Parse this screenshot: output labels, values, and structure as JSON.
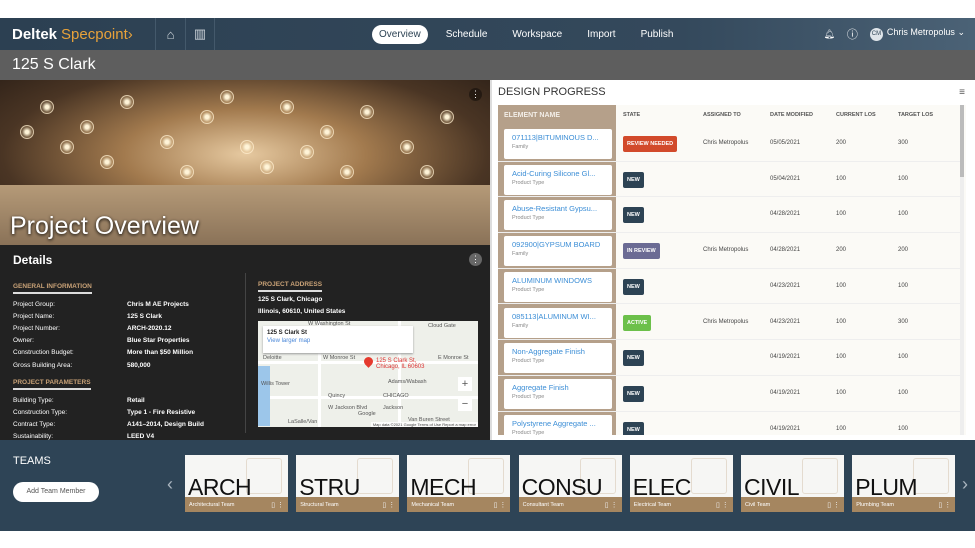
{
  "header": {
    "brand": "Deltek",
    "product": "Specpoint",
    "product_suffix": "›",
    "nav": [
      "Overview",
      "Schedule",
      "Workspace",
      "Import",
      "Publish"
    ],
    "active_tab": "Overview",
    "user_initials": "CM",
    "user_name": "Chris Metropolus",
    "user_chevron": "⌄"
  },
  "page_title": "125 S Clark",
  "hero": {
    "title": "Project Overview"
  },
  "details": {
    "title": "Details",
    "general_heading": "GENERAL INFORMATION",
    "general": [
      {
        "k": "Project Group:",
        "v": "Chris M AE Projects"
      },
      {
        "k": "Project Name:",
        "v": "125 S Clark"
      },
      {
        "k": "Project Number:",
        "v": "ARCH-2020.12"
      },
      {
        "k": "Owner:",
        "v": "Blue Star Properties"
      },
      {
        "k": "Construction Budget:",
        "v": "More than $50 Million"
      },
      {
        "k": "Gross Building Area:",
        "v": "580,000"
      }
    ],
    "params_heading": "PROJECT PARAMETERS",
    "params": [
      {
        "k": "Building Type:",
        "v": "Retail"
      },
      {
        "k": "Construction Type:",
        "v": "Type 1 - Fire Resistive"
      },
      {
        "k": "Contract Type:",
        "v": "A141–2014, Design Build"
      },
      {
        "k": "Sustainability:",
        "v": "LEED V4"
      }
    ],
    "address_heading": "PROJECT ADDRESS",
    "address_line1": "125 S Clark, Chicago",
    "address_line2": "Illinois, 60610, United States",
    "map": {
      "card_title": "125 S Clark St",
      "card_link": "View larger map",
      "pin_label_1": "125 S Clark St,",
      "pin_label_2": "Chicago, IL 60603",
      "labels": [
        "W Washington St",
        "Cloud Gate",
        "Deloitte",
        "W Monroe St",
        "E Monroe St",
        "Willis Tower",
        "Adams/Wabash",
        "Quincy",
        "W Jackson Blvd",
        "Jackson",
        "CHICAGO",
        "Van Buren Street",
        "LaSalle/Van",
        "Google"
      ],
      "footer": "Map data ©2021 Google   Terms of Use   Report a map error",
      "zoom_in": "+",
      "zoom_out": "−"
    }
  },
  "design_progress": {
    "title": "DESIGN PROGRESS",
    "columns": [
      "ELEMENT NAME",
      "STATE",
      "ASSIGNED TO",
      "DATE MODIFIED",
      "CURRENT LOS",
      "TARGET LOS"
    ],
    "rows": [
      {
        "name": "071113|BITUMINOUS D...",
        "type": "Family",
        "state": "REVIEW NEEDED",
        "state_color": "#d24a2b",
        "assigned": "Chris Metropolus",
        "date": "05/05/2021",
        "current": "200",
        "target": "300"
      },
      {
        "name": "Acid-Curing Silicone Gl...",
        "type": "Product Type",
        "state": "NEW",
        "state_color": "#2d4354",
        "assigned": "",
        "date": "05/04/2021",
        "current": "100",
        "target": "100"
      },
      {
        "name": "Abuse-Resistant Gypsu...",
        "type": "Product Type",
        "state": "NEW",
        "state_color": "#2d4354",
        "assigned": "",
        "date": "04/28/2021",
        "current": "100",
        "target": "100"
      },
      {
        "name": "092900|GYPSUM BOARD",
        "type": "Family",
        "state": "IN REVIEW",
        "state_color": "#6b6b94",
        "assigned": "Chris Metropolus",
        "date": "04/28/2021",
        "current": "200",
        "target": "200"
      },
      {
        "name": "ALUMINUM WINDOWS",
        "type": "Product Type",
        "state": "NEW",
        "state_color": "#2d4354",
        "assigned": "",
        "date": "04/23/2021",
        "current": "100",
        "target": "100"
      },
      {
        "name": "085113|ALUMINUM WI...",
        "type": "Family",
        "state": "ACTIVE",
        "state_color": "#6cc04a",
        "assigned": "Chris Metropolus",
        "date": "04/23/2021",
        "current": "100",
        "target": "300"
      },
      {
        "name": "Non-Aggregate Finish",
        "type": "Product Type",
        "state": "NEW",
        "state_color": "#2d4354",
        "assigned": "",
        "date": "04/19/2021",
        "current": "100",
        "target": "100"
      },
      {
        "name": "Aggregate Finish",
        "type": "Product Type",
        "state": "NEW",
        "state_color": "#2d4354",
        "assigned": "",
        "date": "04/19/2021",
        "current": "100",
        "target": "100"
      },
      {
        "name": "Polystyrene Aggregate ...",
        "type": "Product Type",
        "state": "NEW",
        "state_color": "#2d4354",
        "assigned": "",
        "date": "04/19/2021",
        "current": "100",
        "target": "100"
      }
    ]
  },
  "teams": {
    "title": "TEAMS",
    "add_button": "Add Team Member",
    "prev": "‹",
    "next": "›",
    "cards": [
      {
        "abbr": "ARCH",
        "name": "Architectural Team"
      },
      {
        "abbr": "STRU",
        "name": "Structural Team"
      },
      {
        "abbr": "MECH",
        "name": "Mechanical Team"
      },
      {
        "abbr": "CONSU",
        "name": "Consultant Team"
      },
      {
        "abbr": "ELEC",
        "name": "Electrical Team"
      },
      {
        "abbr": "CIVIL",
        "name": "Civil Team"
      },
      {
        "abbr": "PLUM",
        "name": "Plumbing Team"
      }
    ]
  },
  "colors": {
    "header": "#2d4354",
    "accent": "#e8a23a",
    "team_footer": "#a58660",
    "link": "#3c8ed6"
  }
}
